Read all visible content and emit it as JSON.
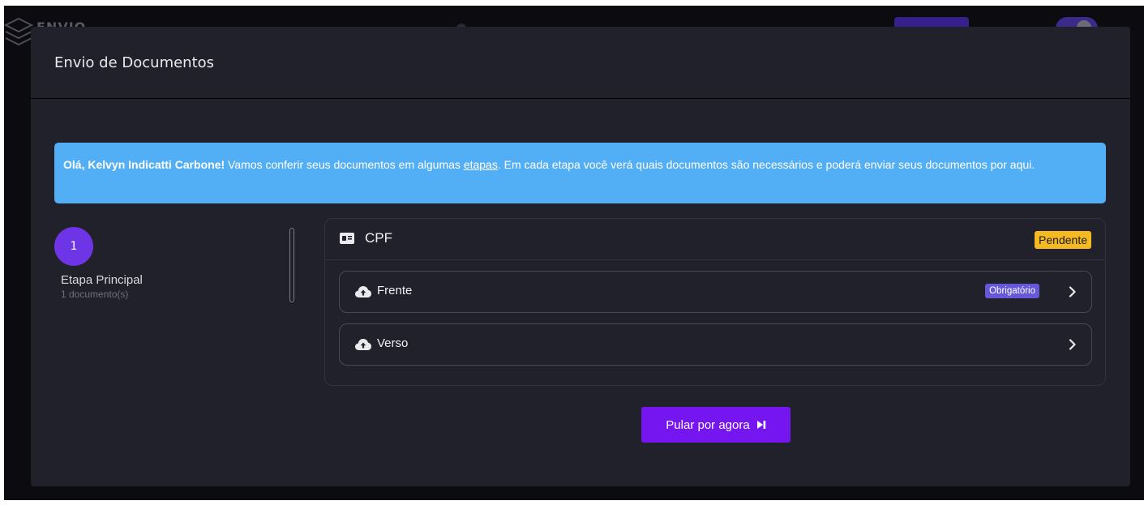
{
  "background": {
    "brand": "ENVIO"
  },
  "modal": {
    "title": "Envio de Documentos"
  },
  "alert": {
    "greeting": "Olá, Kelvyn Indicatti Carbone!",
    "text_before_link": " Vamos conferir seus documentos em algumas ",
    "link": "etapas",
    "text_after_link": ". Em cada etapa você verá quais documentos são necessários e poderá enviar seus documentos por aqui.",
    "color": "#52aef5"
  },
  "steps": [
    {
      "number": "1",
      "name": "Etapa Principal",
      "subtitle": "1 documento(s)"
    }
  ],
  "document": {
    "name": "CPF",
    "icon": "id-card-icon",
    "status": "Pendente",
    "status_color": "#f5b922",
    "items": [
      {
        "label": "Frente",
        "icon": "cloud-upload-icon",
        "badge": "Obrigatório"
      },
      {
        "label": "Verso",
        "icon": "cloud-upload-icon",
        "badge": ""
      }
    ]
  },
  "skip_button": {
    "label": "Pular por agora",
    "icon": "skip-forward-icon",
    "color": "#7516f0"
  }
}
